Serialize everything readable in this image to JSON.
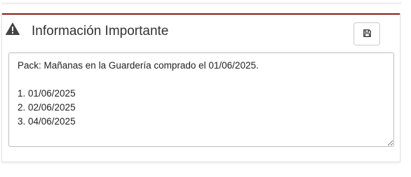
{
  "panel": {
    "title": "Información Importante",
    "accent_color": "#8b1a1a",
    "icons": {
      "warning": "warning-triangle-icon",
      "save": "floppy-disk-icon"
    },
    "notes": "Pack: Mañanas en la Guardería comprado el 01/06/2025.\n\n1. 01/06/2025\n2. 02/06/2025\n3. 04/06/2025"
  }
}
